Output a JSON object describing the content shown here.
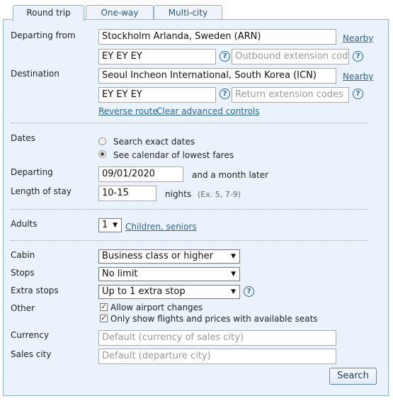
{
  "tabs": {
    "round_trip": "Round trip",
    "one_way": "One-way",
    "multi_city": "Multi-city"
  },
  "form": {
    "departing_from_label": "Departing from",
    "departing_from_value": "Stockholm Arlanda, Sweden (ARN)",
    "nearby": "Nearby",
    "outbound_routing_value": "EY EY EY",
    "outbound_extension_placeholder": "Outbound extension codes",
    "destination_label": "Destination",
    "destination_value": "Seoul Incheon International, South Korea (ICN)",
    "return_routing_value": "EY EY EY",
    "return_extension_placeholder": "Return extension codes",
    "reverse_route": "Reverse route",
    "clear_advanced": "Clear advanced controls",
    "dates_label": "Dates",
    "exact_dates": "Search exact dates",
    "calendar_lowest": "See calendar of lowest fares",
    "departing_label": "Departing",
    "departing_value": "09/01/2020",
    "month_later": "and a month later",
    "length_label": "Length of stay",
    "length_value": "10-15",
    "nights": "nights",
    "nights_hint": "(Ex. 5, 7-9)",
    "adults_label": "Adults",
    "adults_value": "1",
    "children_seniors": "Children, seniors",
    "cabin_label": "Cabin",
    "cabin_value": "Business class or higher",
    "stops_label": "Stops",
    "stops_value": "No limit",
    "extra_stops_label": "Extra stops",
    "extra_stops_value": "Up to 1 extra stop",
    "other_label": "Other",
    "allow_airport_changes": "Allow airport changes",
    "only_available": "Only show flights and prices with available seats",
    "currency_label": "Currency",
    "currency_placeholder": "Default (currency of sales city)",
    "sales_city_label": "Sales city",
    "sales_city_placeholder": "Default (departure city)",
    "search_button": "Search",
    "help_glyph": "?",
    "select_arrow": "▼",
    "check_mark": "✓"
  }
}
